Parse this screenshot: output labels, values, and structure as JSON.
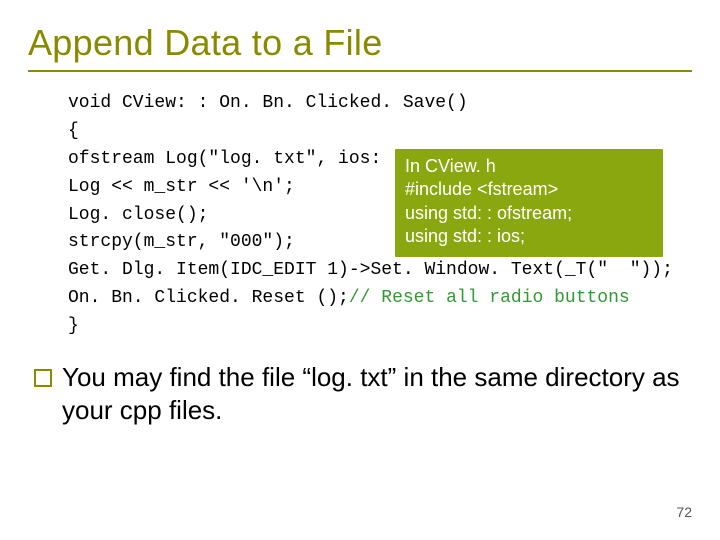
{
  "title": "Append Data to a File",
  "code": {
    "l1": "void CView: : On. Bn. Clicked. Save()",
    "l2": "{",
    "l3": "ofstream Log(\"log. txt\", ios: : app);",
    "l4": "Log << m_str << '\\n';",
    "l5": "Log. close();",
    "l6": "",
    "l7": "strcpy(m_str, \"000\");",
    "l8a": "Get. Dlg. Item(IDC_EDIT 1)->Set. Window. Text(_T(\"",
    "l8b": "  \"));",
    "l9": "",
    "l10a": "On. Bn. Clicked. Reset ();",
    "l10b": "// Reset all radio buttons",
    "l11": "}"
  },
  "callout": {
    "l1": "In CView. h",
    "l2": "#include <fstream>",
    "l3": "using std: : ofstream;",
    "l4": "using std: : ios;"
  },
  "body": "You may find the file “log. txt” in the same directory as your cpp files.",
  "page": "72"
}
